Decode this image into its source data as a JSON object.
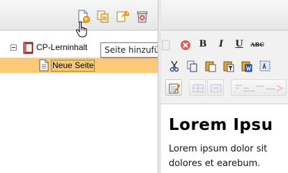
{
  "tree_toolbar": {
    "buttons": [
      {
        "name": "add-page",
        "icon": "add-page-icon",
        "tooltip": "Seite hinzufügen"
      },
      {
        "name": "copy-page",
        "icon": "copy-page-icon"
      },
      {
        "name": "move-page",
        "icon": "move-page-icon"
      },
      {
        "name": "delete-page",
        "icon": "delete-page-icon"
      }
    ]
  },
  "tree": {
    "root": {
      "label": "CP-Lerninhalt",
      "icon": "book-icon",
      "expanded": true
    },
    "children": [
      {
        "label": "Neue Seite",
        "icon": "page-icon",
        "selected": true
      }
    ],
    "selection_color": "#fbc978"
  },
  "tooltip": {
    "text": "Seite hinzufügen"
  },
  "editor": {
    "toolbar_rows": [
      [
        "cut-left",
        "cancel",
        "B",
        "I",
        "U",
        "ABC"
      ],
      [
        "cut",
        "copy",
        "paste",
        "paste-text",
        "paste-word",
        "select-all"
      ],
      [
        "edit",
        "table",
        "table-props",
        "layout"
      ]
    ],
    "bold_label": "B",
    "italic_label": "I",
    "underline_label": "U",
    "strike_label": "ABC",
    "heading": "Lorem Ipsu",
    "body_lines": [
      "Lorem ipsum dolor sit",
      "dolores et earebum."
    ]
  }
}
